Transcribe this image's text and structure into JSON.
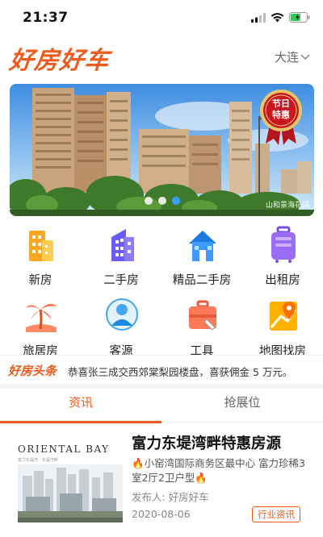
{
  "status_bar": {
    "time": "21:37"
  },
  "header": {
    "logo": "好房好车",
    "city": "大连"
  },
  "banner": {
    "badge_line1": "节日",
    "badge_line2": "特惠",
    "caption": "山和景海花园",
    "slides": 3,
    "active_slide": 3
  },
  "categories": [
    {
      "label": "新房",
      "icon": "building-icon"
    },
    {
      "label": "二手房",
      "icon": "office-building-icon"
    },
    {
      "label": "精品二手房",
      "icon": "house-icon"
    },
    {
      "label": "出租房",
      "icon": "suitcase-icon"
    },
    {
      "label": "旅居房",
      "icon": "palm-tree-icon"
    },
    {
      "label": "客源",
      "icon": "customer-icon"
    },
    {
      "label": "工具",
      "icon": "toolbox-icon"
    },
    {
      "label": "地图找房",
      "icon": "map-pin-icon"
    }
  ],
  "headlines": {
    "logo": "好房头条",
    "text": "恭喜张三成交西郊棠梨园楼盘，喜获佣金 5 万元。"
  },
  "tabs": [
    {
      "label": "资讯",
      "active": true
    },
    {
      "label": "抢展位",
      "active": false
    }
  ],
  "article": {
    "thumb_brand": "ORIENTAL BAY",
    "thumb_sub": "富力东堤湾 · 东堤湾畔",
    "title": "富力东堤湾畔特惠房源",
    "desc": "🔥小窑湾国际商务区最中心 富力珍稀3室2厅2卫户型🔥",
    "publisher": "发布人: 好房好车",
    "date": "2020-08-06",
    "tag": "行业资讯"
  },
  "colors": {
    "accent": "#f05a1a",
    "dot_active": "#3aa0ff"
  }
}
